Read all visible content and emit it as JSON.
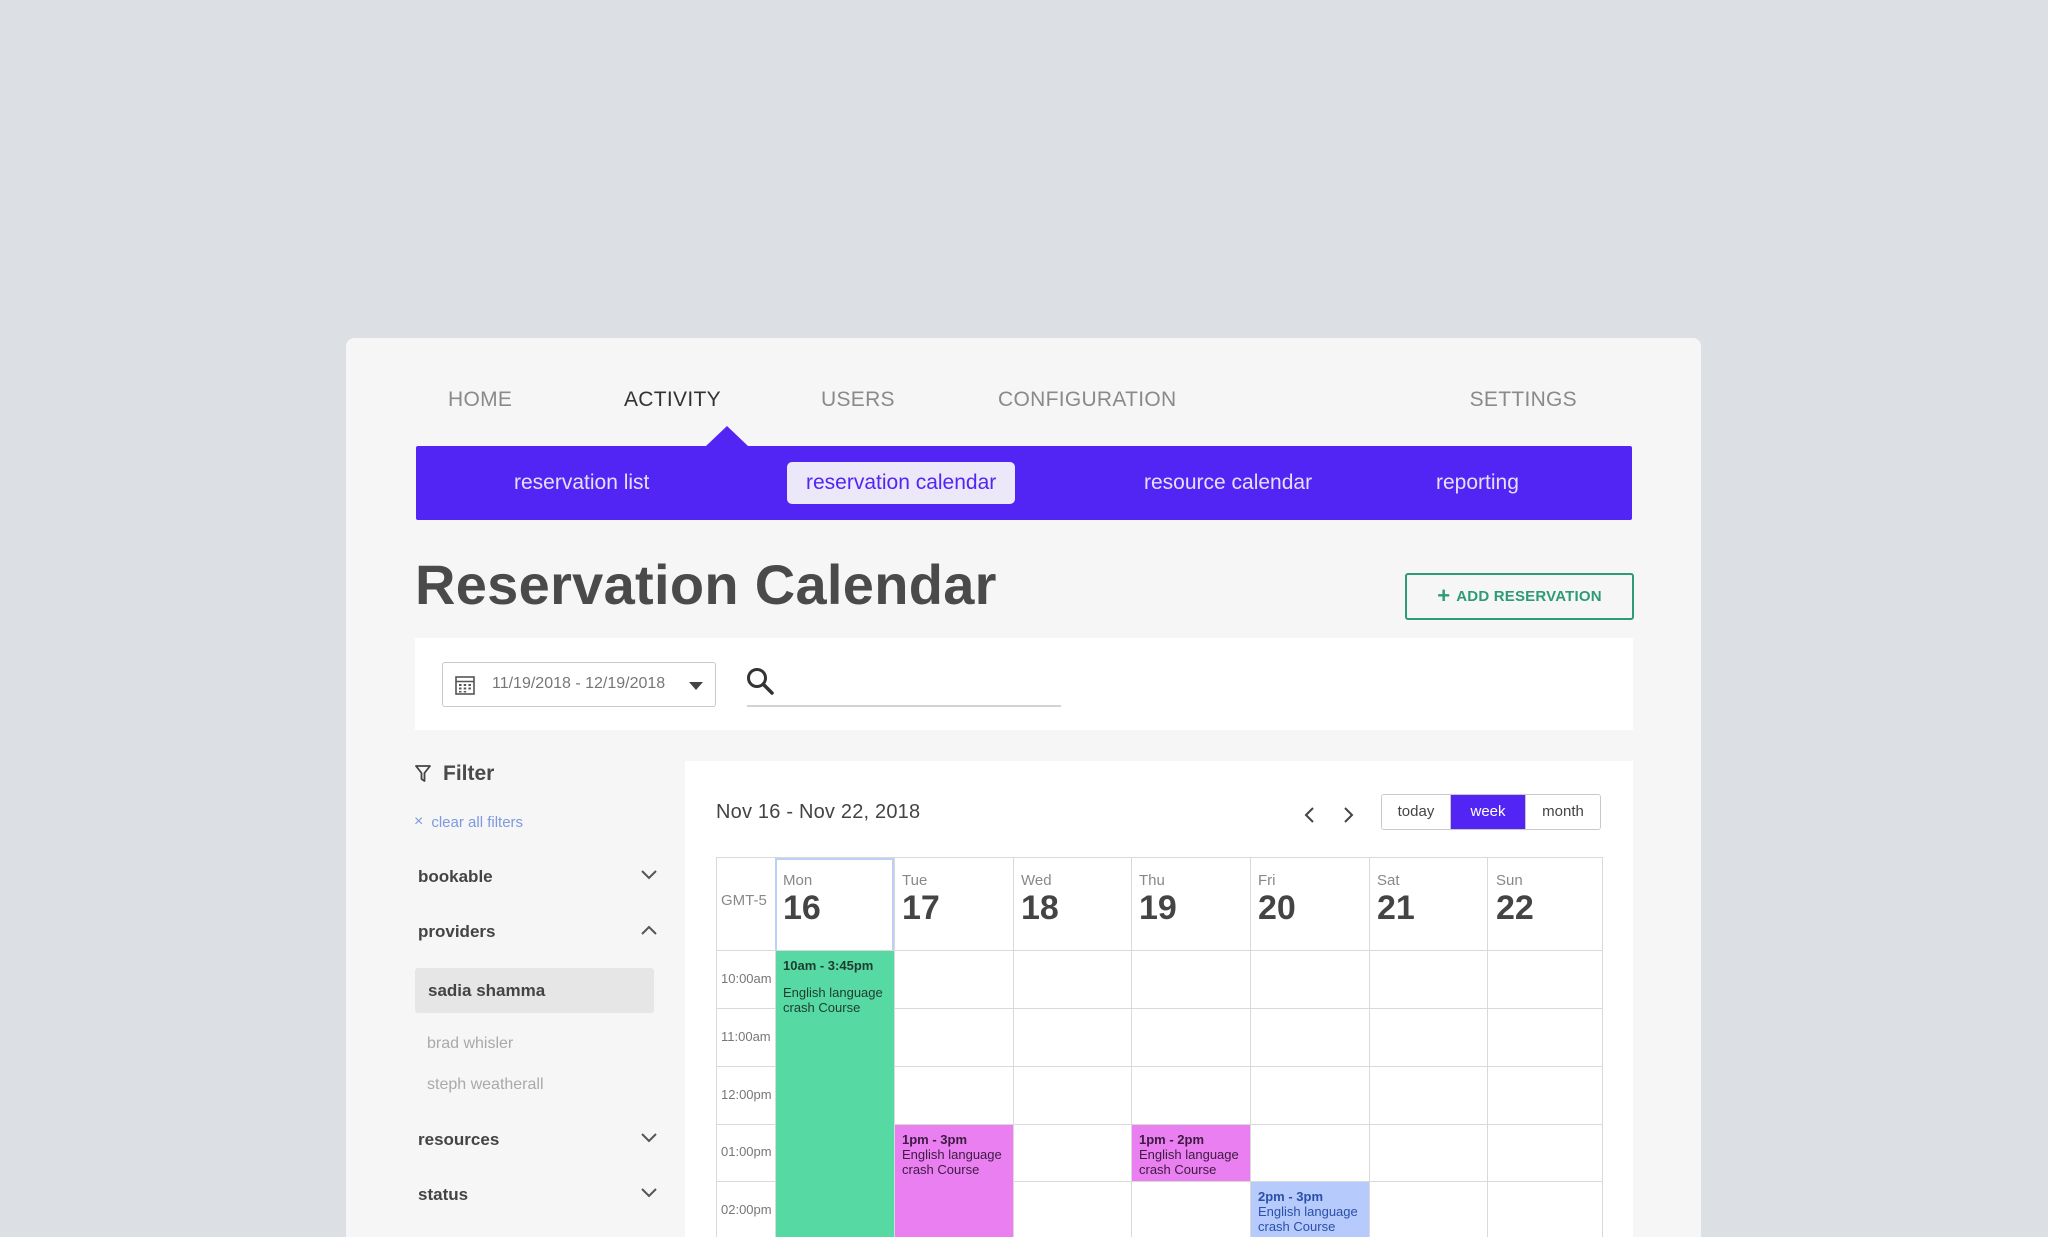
{
  "nav": {
    "items": [
      {
        "label": "HOME"
      },
      {
        "label": "ACTIVITY"
      },
      {
        "label": "USERS"
      },
      {
        "label": "CONFIGURATION"
      },
      {
        "label": "SETTINGS"
      }
    ],
    "active": "ACTIVITY"
  },
  "subnav": {
    "items": [
      {
        "label": "reservation list"
      },
      {
        "label": "reservation calendar"
      },
      {
        "label": "resource calendar"
      },
      {
        "label": "reporting"
      }
    ],
    "active": "reservation calendar"
  },
  "page": {
    "title": "Reservation Calendar",
    "add_button_label": "ADD RESERVATION"
  },
  "search": {
    "date_range": "11/19/2018 - 12/19/2018",
    "query": ""
  },
  "filter": {
    "title": "Filter",
    "clear_label": "clear all filters",
    "groups": {
      "bookable": "bookable",
      "providers": "providers",
      "resources": "resources",
      "status": "status"
    },
    "providers": {
      "selected": "sadia shamma",
      "others": [
        "brad whisler",
        "steph weatherall"
      ]
    }
  },
  "calendar": {
    "range_title": "Nov 16 - Nov 22, 2018",
    "views": [
      "today",
      "week",
      "month"
    ],
    "active_view": "week",
    "timezone": "GMT-5",
    "days": [
      {
        "name": "Mon",
        "date": "16"
      },
      {
        "name": "Tue",
        "date": "17"
      },
      {
        "name": "Wed",
        "date": "18"
      },
      {
        "name": "Thu",
        "date": "19"
      },
      {
        "name": "Fri",
        "date": "20"
      },
      {
        "name": "Sat",
        "date": "21"
      },
      {
        "name": "Sun",
        "date": "22"
      }
    ],
    "times": [
      "10:00am",
      "11:00am",
      "12:00pm",
      "01:00pm",
      "02:00pm"
    ],
    "events": [
      {
        "day": "Mon",
        "time": "10am - 3:45pm",
        "title": "English language crash Course",
        "color": "#56d9a2"
      },
      {
        "day": "Tue",
        "time": "1pm - 3pm",
        "title": "English language crash Course",
        "color": "#e97ff0"
      },
      {
        "day": "Thu",
        "time": "1pm - 2pm",
        "title": "English language crash Course",
        "color": "#e97ff0"
      },
      {
        "day": "Fri",
        "time": "2pm - 3pm",
        "title": "English language crash Course",
        "color": "#b6cbfb"
      }
    ]
  },
  "colors": {
    "accent": "#5225f5",
    "add_button": "#2d9a78",
    "background": "#dcdfe3"
  },
  "icons": {
    "calendar": "calendar-icon",
    "search": "search-icon",
    "filter": "filter-icon",
    "clear": "close-icon",
    "chevron_down": "chevron-down-icon",
    "chevron_up": "chevron-up-icon",
    "prev": "chevron-left-icon",
    "next": "chevron-right-icon",
    "add": "plus-icon"
  }
}
